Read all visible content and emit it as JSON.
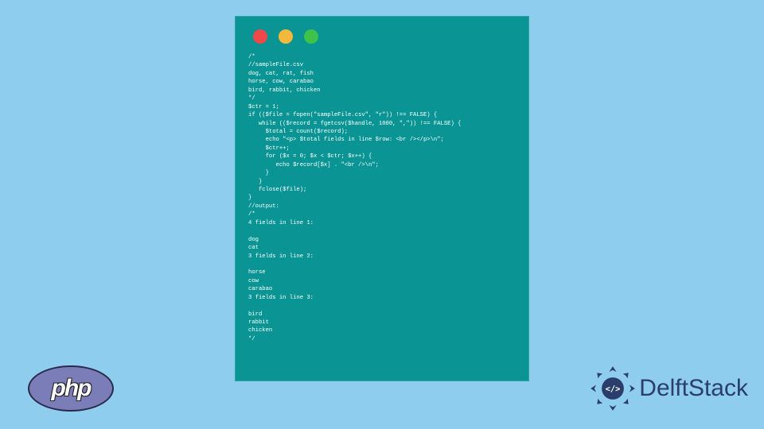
{
  "window": {
    "code": "/*\n//sampleFile.csv\ndog, cat, rat, fish\nhorse, cow, carabao\nbird, rabbit, chicken\n*/\n$ctr = 1;\nif (($file = fopen(\"sampleFile.csv\", \"r\")) !== FALSE) {\n   while (($record = fgetcsv($handle, 1000, \",\")) !== FALSE) {\n     $total = count($record);\n     echo \"<p> $total fields in line $row: <br /></p>\\n\";\n     $ctr++;\n     for ($x = 0; $x < $ctr; $x++) {\n        echo $record[$x] . \"<br />\\n\";\n     }\n   }\n   fclose($file);\n}\n//output:\n/*\n4 fields in line 1:\n\ndog\ncat\n3 fields in line 2:\n\nhorse\ncow\ncarabao\n3 fields in line 3:\n\nbird\nrabbit\nchicken\n*/"
  },
  "logos": {
    "php_text": "php",
    "delft_text": "DelftStack"
  },
  "colors": {
    "background": "#8fcdef",
    "terminal_bg": "#0b9494",
    "dot_red": "#f04848",
    "dot_yellow": "#f5b83d",
    "dot_green": "#3ec24a",
    "php_bg": "#7a7db8",
    "delft_primary": "#2a3d6b"
  }
}
